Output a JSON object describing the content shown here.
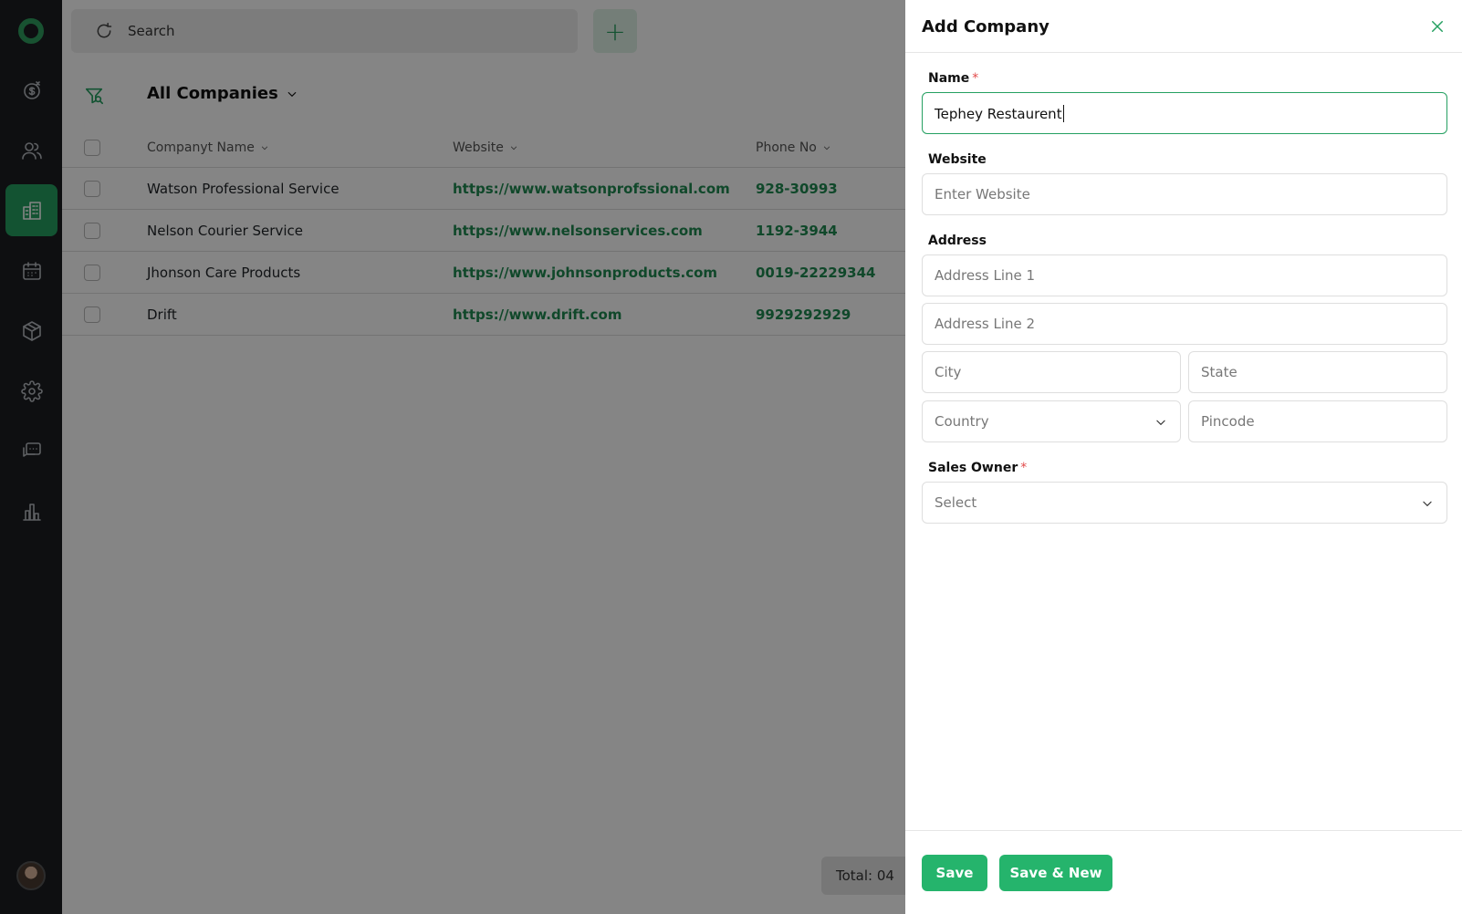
{
  "sidebar": {
    "items": [
      {
        "name": "deals-icon"
      },
      {
        "name": "contacts-icon"
      },
      {
        "name": "companies-icon",
        "active": true
      },
      {
        "name": "calendar-icon"
      },
      {
        "name": "products-icon"
      },
      {
        "name": "settings-icon"
      },
      {
        "name": "chat-icon"
      },
      {
        "name": "reports-icon"
      }
    ]
  },
  "topbar": {
    "search_label": "Search",
    "add_label": "+"
  },
  "list": {
    "view_title": "All Companies",
    "columns": [
      "Companyt Name",
      "Website",
      "Phone No"
    ],
    "rows": [
      {
        "name": "Watson Professional Service",
        "website": "https://www.watsonprofssional.com",
        "phone": "928-30993"
      },
      {
        "name": "Nelson Courier Service",
        "website": "https://www.nelsonservices.com",
        "phone": "1192-3944"
      },
      {
        "name": "Jhonson Care Products",
        "website": "https://www.johnsonproducts.com",
        "phone": "0019-22229344"
      },
      {
        "name": "Drift",
        "website": "https://www.drift.com",
        "phone": "9929292929"
      }
    ],
    "total": "Total: 04"
  },
  "drawer": {
    "title": "Add Company",
    "name_label": "Name",
    "required_mark": "*",
    "name_value": "Tephey Restaurent",
    "website_label": "Website",
    "website_placeholder": "Enter Website",
    "address_label": "Address",
    "address1_placeholder": "Address Line 1",
    "address2_placeholder": "Address Line 2",
    "city_placeholder": "City",
    "state_placeholder": "State",
    "country_placeholder": "Country",
    "pincode_placeholder": "Pincode",
    "sales_owner_label": "Sales Owner",
    "sales_owner_placeholder": "Select",
    "save_label": "Save",
    "save_new_label": "Save & New"
  },
  "colors": {
    "accent": "#25a061",
    "sidebar_bg": "#1c1e22",
    "required": "#e24a4a"
  }
}
